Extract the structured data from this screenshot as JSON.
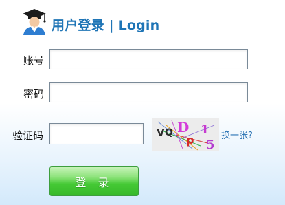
{
  "header": {
    "title": "用户登录 | Login"
  },
  "form": {
    "account": {
      "label": "账号",
      "value": ""
    },
    "password": {
      "label": "密码",
      "value": ""
    },
    "captcha": {
      "label": "验证码",
      "value": "",
      "image_text": "VQDp15",
      "refresh_label": "换一张?"
    },
    "submit_label": "登 录"
  },
  "colors": {
    "title": "#1f75b6",
    "link": "#1f6cb0",
    "button_green": "#45c935",
    "background_blue": "#d3e9fb"
  }
}
